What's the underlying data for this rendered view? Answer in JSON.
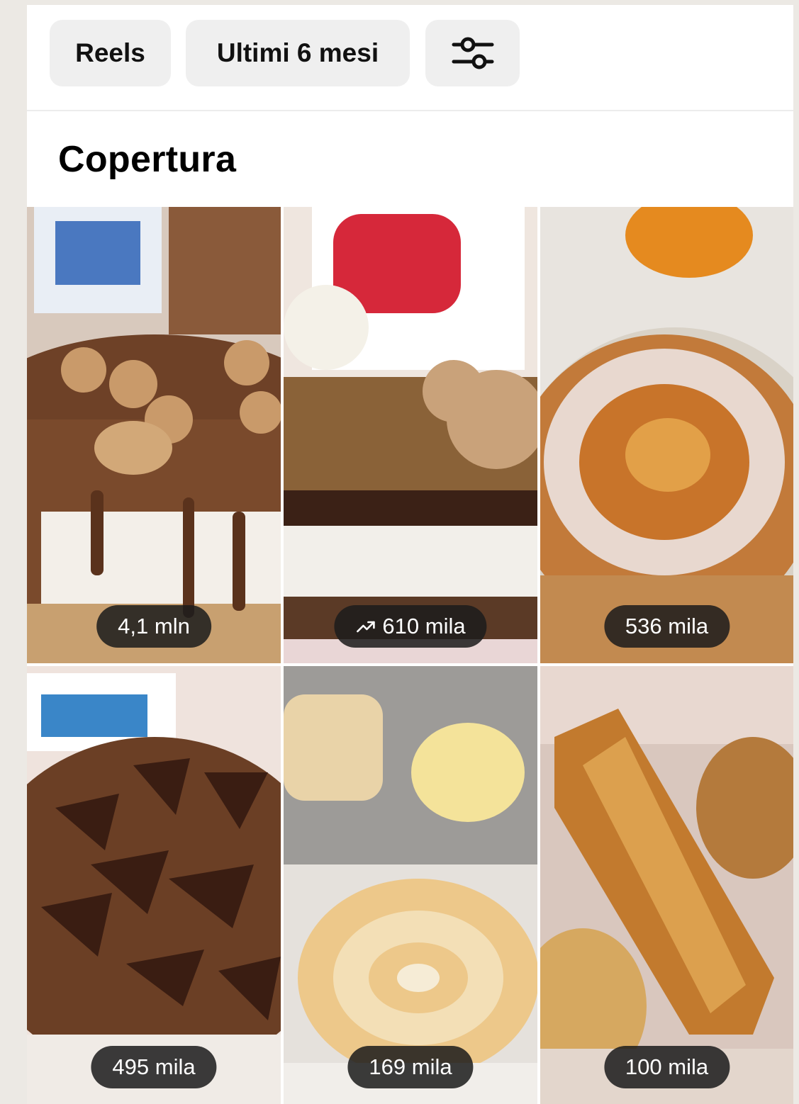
{
  "filters": {
    "type_label": "Reels",
    "period_label": "Ultimi 6 mesi",
    "settings_icon": "sliders-icon"
  },
  "section": {
    "title": "Copertura"
  },
  "reels": [
    {
      "views": "4,1 mln",
      "trending": false,
      "subject": "kinder-hippo-chocolate-cheesecake"
    },
    {
      "views": "610 mila",
      "trending": true,
      "subject": "cookie-crumble-cheesecake"
    },
    {
      "views": "536 mila",
      "trending": false,
      "subject": "apricot-rose-cake"
    },
    {
      "views": "495 mila",
      "trending": false,
      "subject": "kinder-pingui-cheesecake"
    },
    {
      "views": "169 mila",
      "trending": false,
      "subject": "sponge-roll-cake"
    },
    {
      "views": "100 mila",
      "trending": false,
      "subject": "puff-pastry-twist"
    }
  ],
  "colors": {
    "chip_bg": "#efefef",
    "badge_bg": "#1c1c1c",
    "page_bg": "#ece9e4"
  }
}
